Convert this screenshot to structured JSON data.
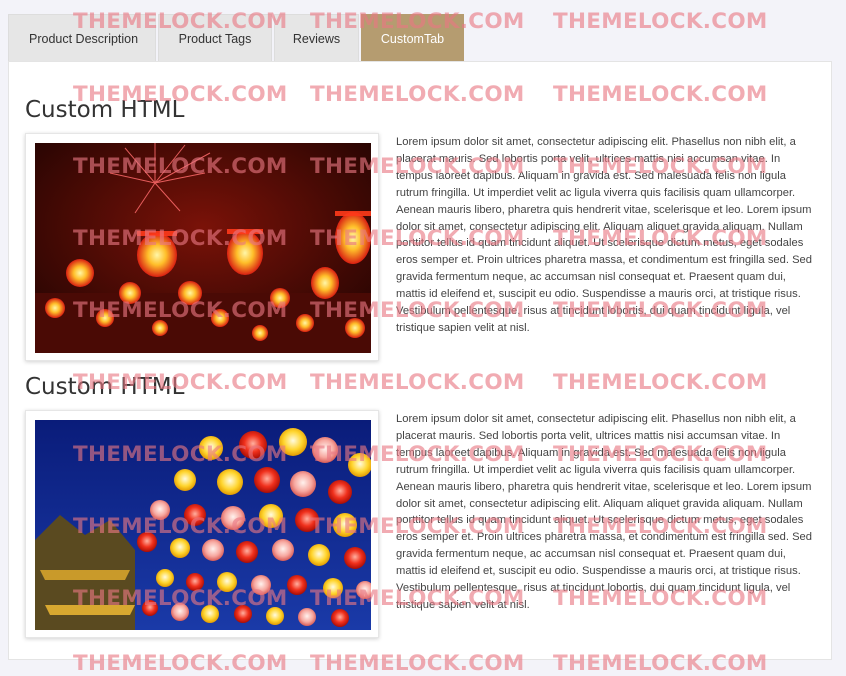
{
  "tabs": [
    "Product Description",
    "Product Tags",
    "Reviews",
    "CustomTab"
  ],
  "active_tab": "CustomTab",
  "sections": [
    {
      "heading": "Custom HTML",
      "image": "red-lanterns-fireworks-photo",
      "text": "Lorem ipsum dolor sit amet, consectetur adipiscing elit. Phasellus non nibh elit, a placerat mauris. Sed lobortis porta velit, ultrices mattis nisi accumsan vitae. In tempus laoreet dapibus. Aliquam in gravida est. Sed malesuada felis non ligula rutrum fringilla. Ut imperdiet velit ac ligula viverra quis facilisis quam ullamcorper. Aenean mauris libero, pharetra quis hendrerit vitae, scelerisque et leo. Lorem ipsum dolor sit amet, consectetur adipiscing elit. Aliquam aliquet gravida aliquam. Nullam porttitor tellus id quam tincidunt aliquet. Ut scelerisque dictum metus, eget sodales eros semper et. Proin ultrices pharetra massa, et condimentum est fringilla sed. Sed gravida fermentum neque, ac accumsan nisl consequat et. Praesent quam dui, mattis id eleifend et, suscipit eu odio. Suspendisse a mauris orci, at tristique risus. Vestibulum pellentesque, risus at tincidunt lobortis, dui quam tincidunt ligula, vel tristique sapien velit at nisl."
    },
    {
      "heading": "Custom HTML",
      "image": "lantern-festival-night-photo",
      "text": "Lorem ipsum dolor sit amet, consectetur adipiscing elit. Phasellus non nibh elit, a placerat mauris. Sed lobortis porta velit, ultrices mattis nisi accumsan vitae. In tempus laoreet dapibus. Aliquam in gravida est. Sed malesuada felis non ligula rutrum fringilla. Ut imperdiet velit ac ligula viverra quis facilisis quam ullamcorper. Aenean mauris libero, pharetra quis hendrerit vitae, scelerisque et leo. Lorem ipsum dolor sit amet, consectetur adipiscing elit. Aliquam aliquet gravida aliquam. Nullam porttitor tellus id quam tincidunt aliquet. Ut scelerisque dictum metus, eget sodales eros semper et. Proin ultrices pharetra massa, et condimentum est fringilla sed. Sed gravida fermentum neque, ac accumsan nisl consequat et. Praesent quam dui, mattis id eleifend et, suscipit eu odio. Suspendisse a mauris orci, at tristique risus. Vestibulum pellentesque, risus at tincidunt lobortis, dui quam tincidunt ligula, vel tristique sapien velit at nisl."
    }
  ],
  "watermark": "THEMELOCK.COM",
  "colors": {
    "active_tab": "#b59c70",
    "tab": "#e6e6e6",
    "watermark": "#e87882",
    "page_bg": "#f3f3f9"
  }
}
